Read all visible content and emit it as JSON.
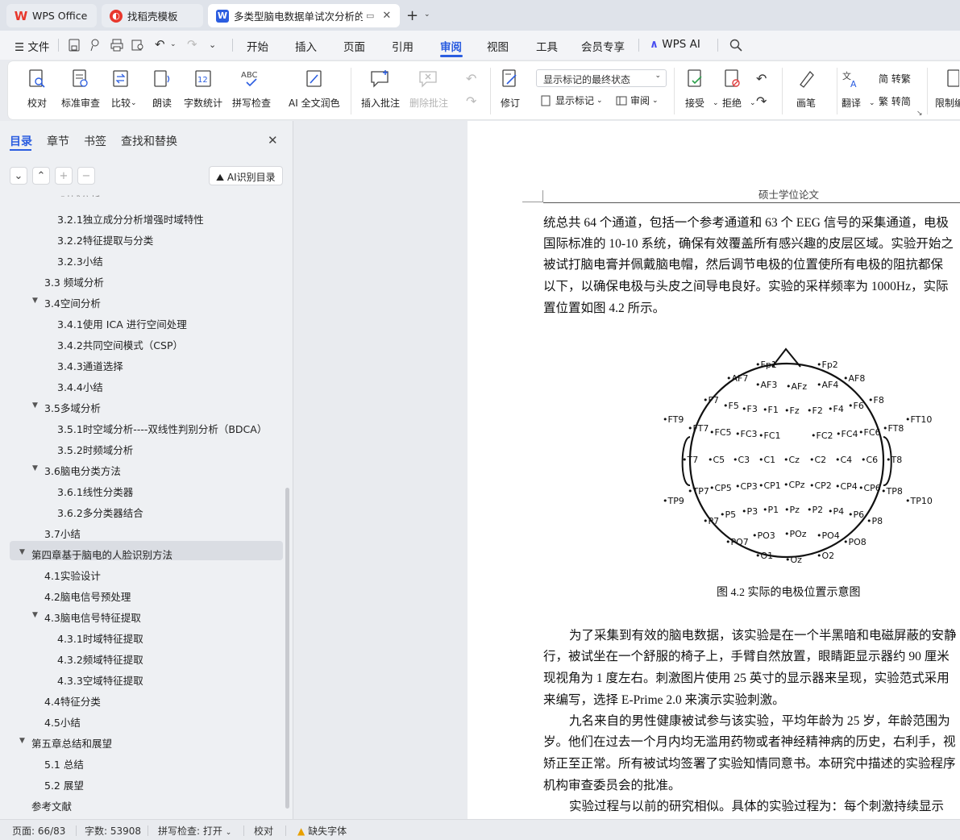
{
  "tabs": [
    {
      "label": "WPS Office"
    },
    {
      "label": "找稻壳模板"
    },
    {
      "label": "多类型脑电数据单试次分析的"
    }
  ],
  "menu": {
    "file": "文件",
    "items": [
      "开始",
      "插入",
      "页面",
      "引用",
      "审阅",
      "视图",
      "工具",
      "会员专享"
    ],
    "wps_ai": "WPS AI",
    "active": "审阅"
  },
  "ribbon": {
    "proofread": "校对",
    "standard_review": "标准审查",
    "compare": "比较",
    "read_aloud": "朗读",
    "word_count": "字数统计",
    "spell_check": "拼写检查",
    "ai_polish": "AI 全文润色",
    "insert_comment": "插入批注",
    "delete_comment": "删除批注",
    "track_changes": "修订",
    "display_mode": "显示标记的最终状态",
    "show_markup": "显示标记",
    "review": "审阅",
    "accept": "接受",
    "reject": "拒绝",
    "pen": "画笔",
    "translate": "翻译",
    "to_simplified": "简 转繁",
    "to_traditional": "繁 转简",
    "restrict": "限制编"
  },
  "nav": {
    "tabs": [
      "目录",
      "章节",
      "书签",
      "查找和替换"
    ],
    "ai_toc": "AI识别目录",
    "toc": [
      {
        "label": "3.2.1独立成分分析增强时域特性"
      },
      {
        "label": "3.2.2特征提取与分类"
      },
      {
        "label": "3.2.3小结"
      },
      {
        "label": "3.3  频域分析"
      },
      {
        "label": "3.4空间分析"
      },
      {
        "label": "3.4.1使用 ICA 进行空间处理"
      },
      {
        "label": "3.4.2共同空间模式（CSP）"
      },
      {
        "label": "3.4.3通道选择"
      },
      {
        "label": "3.4.4小结"
      },
      {
        "label": "3.5多域分析"
      },
      {
        "label": "3.5.1时空域分析----双线性判别分析（BDCA）"
      },
      {
        "label": "3.5.2时频域分析"
      },
      {
        "label": "3.6脑电分类方法"
      },
      {
        "label": "3.6.1线性分类器"
      },
      {
        "label": "3.6.2多分类器结合"
      },
      {
        "label": "3.7小结"
      },
      {
        "label": "第四章基于脑电的人脸识别方法"
      },
      {
        "label": "4.1实验设计"
      },
      {
        "label": "4.2脑电信号预处理"
      },
      {
        "label": "4.3脑电信号特征提取"
      },
      {
        "label": "4.3.1时域特征提取"
      },
      {
        "label": "4.3.2频域特征提取"
      },
      {
        "label": "4.3.3空域特征提取"
      },
      {
        "label": "4.4特征分类"
      },
      {
        "label": "4.5小结"
      },
      {
        "label": "第五章总结和展望"
      },
      {
        "label": "5.1  总结"
      },
      {
        "label": "5.2  展望"
      },
      {
        "label": "参考文献"
      }
    ]
  },
  "doc": {
    "header": "硕士学位论文",
    "lines": [
      "统总共 64 个通道，包括一个参考通道和 63 个 EEG 信号的采集通道，电极",
      "国际标准的 10-10 系统，确保有效覆盖所有感兴趣的皮层区域。实验开始之",
      "被试打脑电膏并佩戴脑电帽，然后调节电极的位置使所有电极的阻抗都保",
      "以下，以确保电极与头皮之间导电良好。实验的采样频率为 1000Hz，实际",
      "置位置如图 4.2 所示。"
    ],
    "figure_caption": "图 4.2  实际的电极位置示意图",
    "lines2": [
      "为了采集到有效的脑电数据，该实验是在一个半黑暗和电磁屏蔽的安静",
      "行，被试坐在一个舒服的椅子上，手臂自然放置，眼睛距显示器约 90 厘米",
      "现视角为 1 度左右。刺激图片使用 25 英寸的显示器来呈现，实验范式采用",
      "来编写，选择 E-Prime 2.0 来演示实验刺激。",
      "九名来自的男性健康被试参与该实验，平均年龄为 25 岁，年龄范围为",
      "岁。他们在过去一个月内均无滥用药物或者神经精神病的历史，右利手，视",
      "矫正至正常。所有被试均签署了实验知情同意书。本研究中描述的实验程序",
      "机构审查委员会的批准。",
      "实验过程与以前的研究相似。具体的实验过程为：每个刺激持续显示"
    ],
    "electrodes": [
      "Fp1",
      "Fp2",
      "AF7",
      "AF3",
      "AFz",
      "AF4",
      "AF8",
      "F7",
      "F5",
      "F3",
      "F1",
      "Fz",
      "F2",
      "F4",
      "F6",
      "F8",
      "FT9",
      "FT7",
      "FC5",
      "FC3",
      "FC1",
      "FC2",
      "FC4",
      "FC6",
      "FT8",
      "FT10",
      "T7",
      "C5",
      "C3",
      "C1",
      "Cz",
      "C2",
      "C4",
      "C6",
      "T8",
      "TP9",
      "TP7",
      "CP5",
      "CP3",
      "CP1",
      "CPz",
      "CP2",
      "CP4",
      "CP6",
      "TP8",
      "TP10",
      "P7",
      "P5",
      "P3",
      "P1",
      "Pz",
      "P2",
      "P4",
      "P6",
      "P8",
      "PO7",
      "PO3",
      "POz",
      "PO4",
      "PO8",
      "O1",
      "Oz",
      "O2"
    ]
  },
  "status": {
    "page": "页面: 66/83",
    "words": "字数: 53908",
    "spell": "拼写检查: 打开",
    "proof": "校对",
    "missing_font": "缺失字体"
  },
  "colors": {
    "accent": "#2b5de0",
    "wps_red": "#e8372c"
  }
}
